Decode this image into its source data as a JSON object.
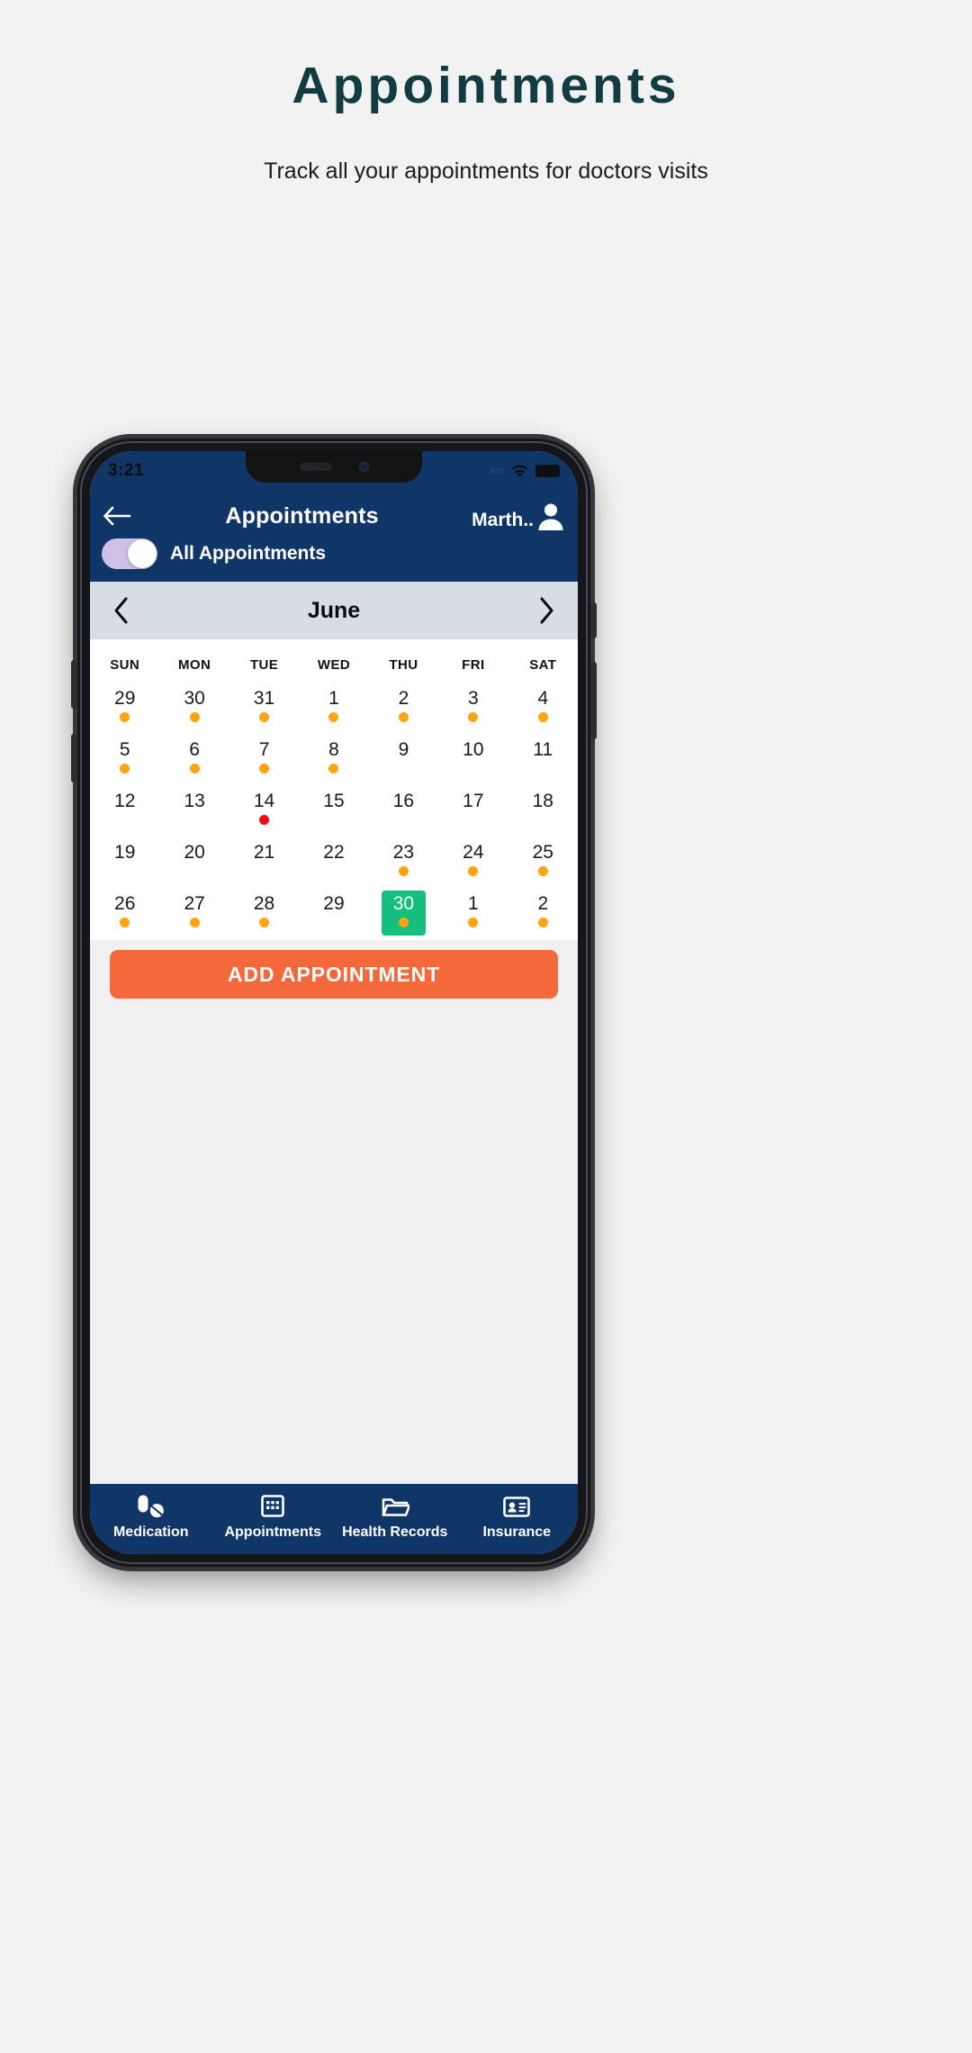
{
  "poster": {
    "title": "Appointments",
    "subtitle": "Track all your appointments for doctors visits",
    "title_color": "#123c41"
  },
  "phone": {
    "status_bar": {
      "time": "3:21",
      "carrier": "Airt",
      "wifi_icon": "wifi-icon",
      "battery_icon": "battery-icon"
    }
  },
  "app": {
    "header": {
      "back_icon": "back-arrow-icon",
      "title": "Appointments",
      "user_name": "Marth..",
      "avatar_icon": "person-avatar-icon",
      "bar_color": "#103567"
    },
    "toggle": {
      "label": "All Appointments",
      "state": "on",
      "track_color": "#cfc0e6"
    },
    "calendar": {
      "prev_icon": "chevron-left-icon",
      "next_icon": "chevron-right-icon",
      "month": "June",
      "weekdays": [
        "SUN",
        "MON",
        "TUE",
        "WED",
        "THU",
        "FRI",
        "SAT"
      ],
      "selected_day": "30",
      "selected_color": "#15bf7e",
      "dot_colors": {
        "appointment": "#ffa412",
        "alert": "#f50b0b"
      },
      "weeks": [
        [
          {
            "n": "29",
            "dot": "orange",
            "sel": false
          },
          {
            "n": "30",
            "dot": "orange",
            "sel": false
          },
          {
            "n": "31",
            "dot": "orange",
            "sel": false
          },
          {
            "n": "1",
            "dot": "orange",
            "sel": false
          },
          {
            "n": "2",
            "dot": "orange",
            "sel": false
          },
          {
            "n": "3",
            "dot": "orange",
            "sel": false
          },
          {
            "n": "4",
            "dot": "orange",
            "sel": false
          }
        ],
        [
          {
            "n": "5",
            "dot": "orange",
            "sel": false
          },
          {
            "n": "6",
            "dot": "orange",
            "sel": false
          },
          {
            "n": "7",
            "dot": "orange",
            "sel": false
          },
          {
            "n": "8",
            "dot": "orange",
            "sel": false
          },
          {
            "n": "9",
            "dot": "none",
            "sel": false
          },
          {
            "n": "10",
            "dot": "none",
            "sel": false
          },
          {
            "n": "11",
            "dot": "none",
            "sel": false
          }
        ],
        [
          {
            "n": "12",
            "dot": "none",
            "sel": false
          },
          {
            "n": "13",
            "dot": "none",
            "sel": false
          },
          {
            "n": "14",
            "dot": "red",
            "sel": false
          },
          {
            "n": "15",
            "dot": "none",
            "sel": false
          },
          {
            "n": "16",
            "dot": "none",
            "sel": false
          },
          {
            "n": "17",
            "dot": "none",
            "sel": false
          },
          {
            "n": "18",
            "dot": "none",
            "sel": false
          }
        ],
        [
          {
            "n": "19",
            "dot": "none",
            "sel": false
          },
          {
            "n": "20",
            "dot": "none",
            "sel": false
          },
          {
            "n": "21",
            "dot": "none",
            "sel": false
          },
          {
            "n": "22",
            "dot": "none",
            "sel": false
          },
          {
            "n": "23",
            "dot": "orange",
            "sel": false
          },
          {
            "n": "24",
            "dot": "orange",
            "sel": false
          },
          {
            "n": "25",
            "dot": "orange",
            "sel": false
          }
        ],
        [
          {
            "n": "26",
            "dot": "orange",
            "sel": false
          },
          {
            "n": "27",
            "dot": "orange",
            "sel": false
          },
          {
            "n": "28",
            "dot": "orange",
            "sel": false
          },
          {
            "n": "29",
            "dot": "none",
            "sel": false
          },
          {
            "n": "30",
            "dot": "orange",
            "sel": true
          },
          {
            "n": "1",
            "dot": "orange",
            "sel": false
          },
          {
            "n": "2",
            "dot": "orange",
            "sel": false
          }
        ]
      ]
    },
    "add_button": {
      "label": "ADD APPOINTMENT",
      "color": "#f4693c"
    },
    "bottom_nav": {
      "items": [
        {
          "label": "Medication",
          "icon": "pills-icon",
          "active": false
        },
        {
          "label": "Appointments",
          "icon": "calendar-icon",
          "active": true
        },
        {
          "label": "Health Records",
          "icon": "folder-icon",
          "active": false
        },
        {
          "label": "Insurance",
          "icon": "id-card-icon",
          "active": false
        }
      ]
    }
  }
}
